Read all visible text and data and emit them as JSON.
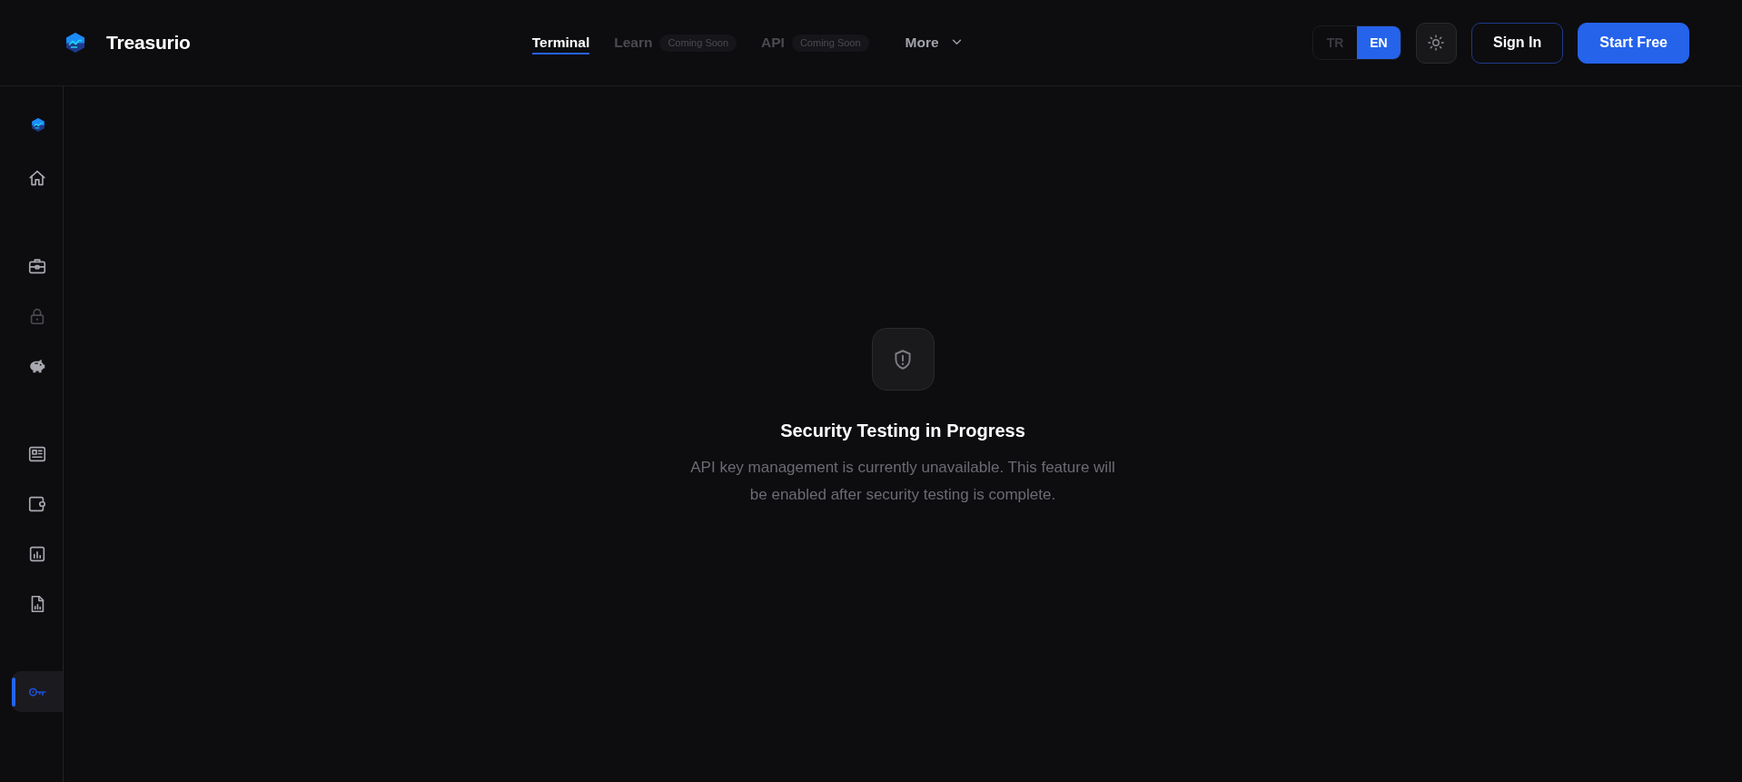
{
  "header": {
    "brand": {
      "name": "Treasurio"
    },
    "nav": [
      {
        "label": "Terminal",
        "kind": "link",
        "selected": true,
        "disabled": false
      },
      {
        "label": "Learn",
        "kind": "link",
        "badge": "Coming Soon",
        "selected": false,
        "disabled": true
      },
      {
        "label": "API",
        "kind": "link",
        "badge": "Coming Soon",
        "selected": false,
        "disabled": true
      },
      {
        "label": "More",
        "kind": "menu",
        "selected": false,
        "disabled": false
      }
    ],
    "languages": [
      {
        "label": "TR",
        "selected": false
      },
      {
        "label": "EN",
        "selected": true
      }
    ],
    "buttons": [
      {
        "label": "Sign In",
        "kind": "outline"
      },
      {
        "label": "Start Free",
        "kind": "primary"
      }
    ]
  },
  "sidebar": {
    "groups": [
      {
        "items": [
          {
            "selected": false,
            "disabled": false
          }
        ]
      },
      {
        "items": [
          {
            "selected": false,
            "disabled": false
          },
          {
            "selected": false,
            "disabled": true
          },
          {
            "selected": false,
            "disabled": false
          }
        ]
      },
      {
        "items": [
          {
            "selected": false,
            "disabled": false
          },
          {
            "selected": false,
            "disabled": false
          },
          {
            "selected": false,
            "disabled": false
          },
          {
            "selected": false,
            "disabled": false
          }
        ]
      },
      {
        "items": [
          {
            "selected": true,
            "disabled": false
          }
        ]
      }
    ]
  },
  "notice": {
    "title": "Security Testing in Progress",
    "description": "API key management is currently unavailable. This feature will be enabled after security testing is complete."
  }
}
